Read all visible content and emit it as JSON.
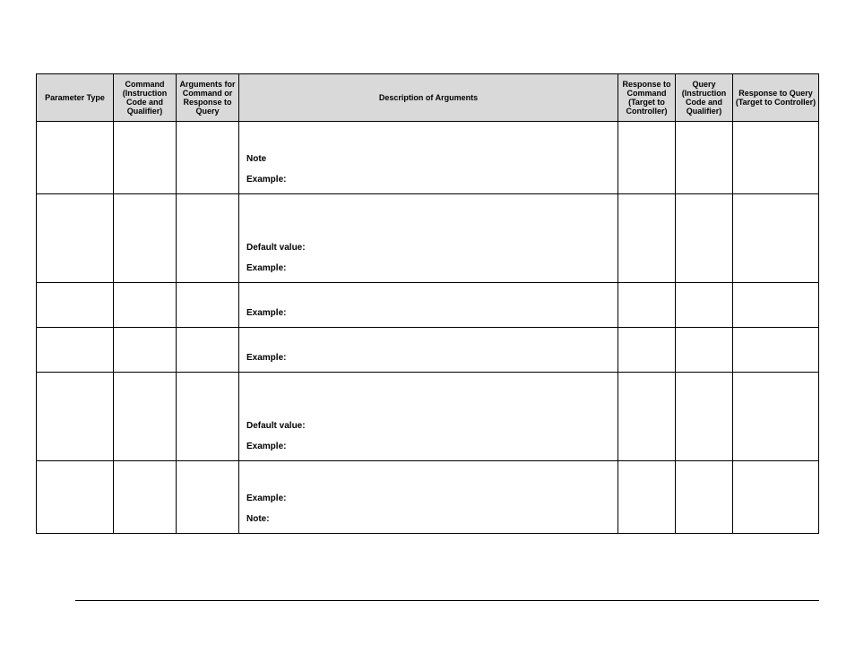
{
  "headers": {
    "h1": "Parameter Type",
    "h2": "Command (Instruction Code and Qualifier)",
    "h3": "Arguments for Command or Response to Query",
    "h4": "Description of Arguments",
    "h5": "Response to Command (Target to Controller)",
    "h6": "Query (Instruction Code and Qualifier)",
    "h7": "Response to Query (Target to Controller)"
  },
  "rows": [
    {
      "desc": [
        {
          "class": "spacer-top"
        },
        {
          "text": "Note"
        },
        {
          "class": "spacer-gap"
        },
        {
          "text": "Example:"
        }
      ]
    },
    {
      "desc": [
        {
          "class": "spacer-top-big"
        },
        {
          "text": "Default value:"
        },
        {
          "class": "spacer-gap"
        },
        {
          "text": "Example:"
        }
      ]
    },
    {
      "desc": [
        {
          "class": "spacer-top-small"
        },
        {
          "text": "Example:"
        }
      ]
    },
    {
      "desc": [
        {
          "class": "spacer-top-small"
        },
        {
          "text": "Example:"
        }
      ]
    },
    {
      "desc": [
        {
          "class": "spacer-top-big"
        },
        {
          "text": "Default value:"
        },
        {
          "class": "spacer-gap"
        },
        {
          "text": "Example:"
        }
      ]
    },
    {
      "desc": [
        {
          "class": "spacer-top"
        },
        {
          "text": "Example:"
        },
        {
          "class": "spacer-gap"
        },
        {
          "text": "Note:"
        }
      ]
    }
  ]
}
